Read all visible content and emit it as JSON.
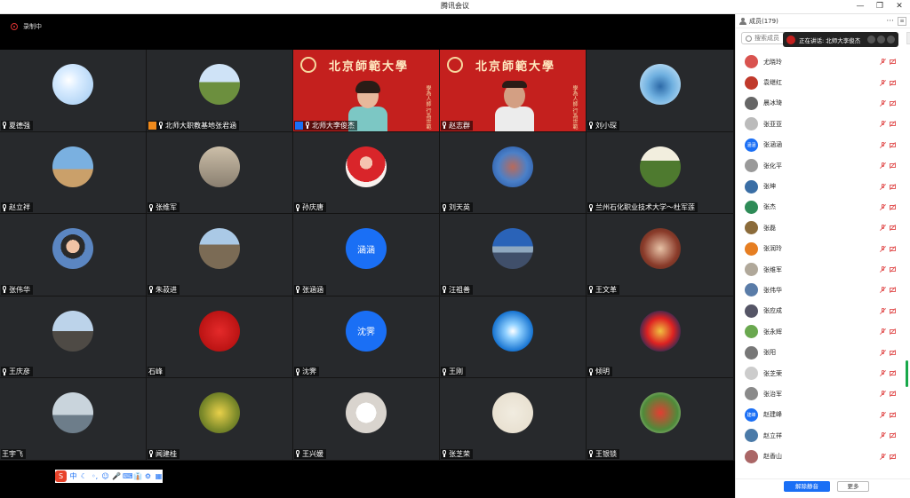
{
  "window": {
    "title": "腾讯会议",
    "controls": [
      "—",
      "❐",
      "✕"
    ]
  },
  "recording": {
    "label": "录制中"
  },
  "tiles": [
    {
      "name": "夏德强",
      "avatar": "sky",
      "badge": ""
    },
    {
      "name": "北师大职教基地张君涵",
      "avatar": "mountain",
      "badge": "org"
    },
    {
      "name": "北师大李俊杰",
      "avatar": "video-woman",
      "badge": "blue"
    },
    {
      "name": "赵志群",
      "avatar": "video-man",
      "badge": ""
    },
    {
      "name": "刘小琛",
      "avatar": "blue-art",
      "badge": ""
    },
    {
      "name": "赵立祥",
      "avatar": "beach",
      "badge": ""
    },
    {
      "name": "张维军",
      "avatar": "stone",
      "badge": ""
    },
    {
      "name": "孙庆唐",
      "avatar": "girl",
      "badge": ""
    },
    {
      "name": "刘天英",
      "avatar": "tree",
      "badge": ""
    },
    {
      "name": "兰州石化职业技术大学～杜军莲",
      "avatar": "field",
      "badge": ""
    },
    {
      "name": "张伟华",
      "avatar": "kid",
      "badge": ""
    },
    {
      "name": "朱菽进",
      "avatar": "valley",
      "badge": ""
    },
    {
      "name": "张涵涵",
      "avatar": "text",
      "avatar_text": "涵涵",
      "badge": ""
    },
    {
      "name": "汪祖善",
      "avatar": "lake",
      "badge": ""
    },
    {
      "name": "王文革",
      "avatar": "food",
      "badge": ""
    },
    {
      "name": "王庆彦",
      "avatar": "tower",
      "badge": ""
    },
    {
      "name": "石峰",
      "avatar": "red-stone",
      "badge": "",
      "no_mic": true
    },
    {
      "name": "沈霁",
      "avatar": "text",
      "avatar_text": "沈霁",
      "badge": ""
    },
    {
      "name": "王刚",
      "avatar": "star",
      "badge": ""
    },
    {
      "name": "倾明",
      "avatar": "emblem",
      "badge": ""
    },
    {
      "name": "王宇飞",
      "avatar": "pier",
      "badge": "",
      "no_mic": true
    },
    {
      "name": "闻建桂",
      "avatar": "flowers",
      "badge": ""
    },
    {
      "name": "王兴媛",
      "avatar": "mug",
      "badge": ""
    },
    {
      "name": "张芝荣",
      "avatar": "figure",
      "badge": ""
    },
    {
      "name": "王银锁",
      "avatar": "tulips",
      "badge": ""
    }
  ],
  "banner_text": "北京師範大學",
  "calligraphy": "學為人師 行為世範",
  "panel": {
    "title": "成员(179)",
    "more": "···",
    "search_placeholder": "搜索成员",
    "speaking": "正在讲话: 北师大李俊杰",
    "members": [
      {
        "name": "尤晓玲",
        "color": "#d9534f"
      },
      {
        "name": "袁继红",
        "color": "#c0392b"
      },
      {
        "name": "晨冰琦",
        "color": "#666"
      },
      {
        "name": "张亚亚",
        "color": "#bbb"
      },
      {
        "name": "张涵涵",
        "color": "#1a6ff5",
        "text": "涵涵"
      },
      {
        "name": "张化平",
        "color": "#999"
      },
      {
        "name": "张坤",
        "color": "#3a6ea5"
      },
      {
        "name": "张杰",
        "color": "#2e8b57"
      },
      {
        "name": "张磊",
        "color": "#8b6b3a"
      },
      {
        "name": "张润玲",
        "color": "#e67e22"
      },
      {
        "name": "张维军",
        "color": "#b0a89a"
      },
      {
        "name": "张伟华",
        "color": "#5a7ca8"
      },
      {
        "name": "张应成",
        "color": "#556"
      },
      {
        "name": "张永辉",
        "color": "#6aa84f"
      },
      {
        "name": "张阳",
        "color": "#777"
      },
      {
        "name": "张芝荣",
        "color": "#ccc"
      },
      {
        "name": "张治军",
        "color": "#8a8a8a"
      },
      {
        "name": "赵建峰",
        "color": "#1a6ff5",
        "text": "建峰"
      },
      {
        "name": "赵立祥",
        "color": "#4a7aa8"
      },
      {
        "name": "赵香山",
        "color": "#a66"
      }
    ],
    "mute_all": "解除静音",
    "more_btn": "更多"
  },
  "ime": [
    "S",
    "中",
    "☾",
    "◦,",
    "☺",
    "🎤",
    "⌨",
    "👔",
    "⚙",
    "▦"
  ]
}
